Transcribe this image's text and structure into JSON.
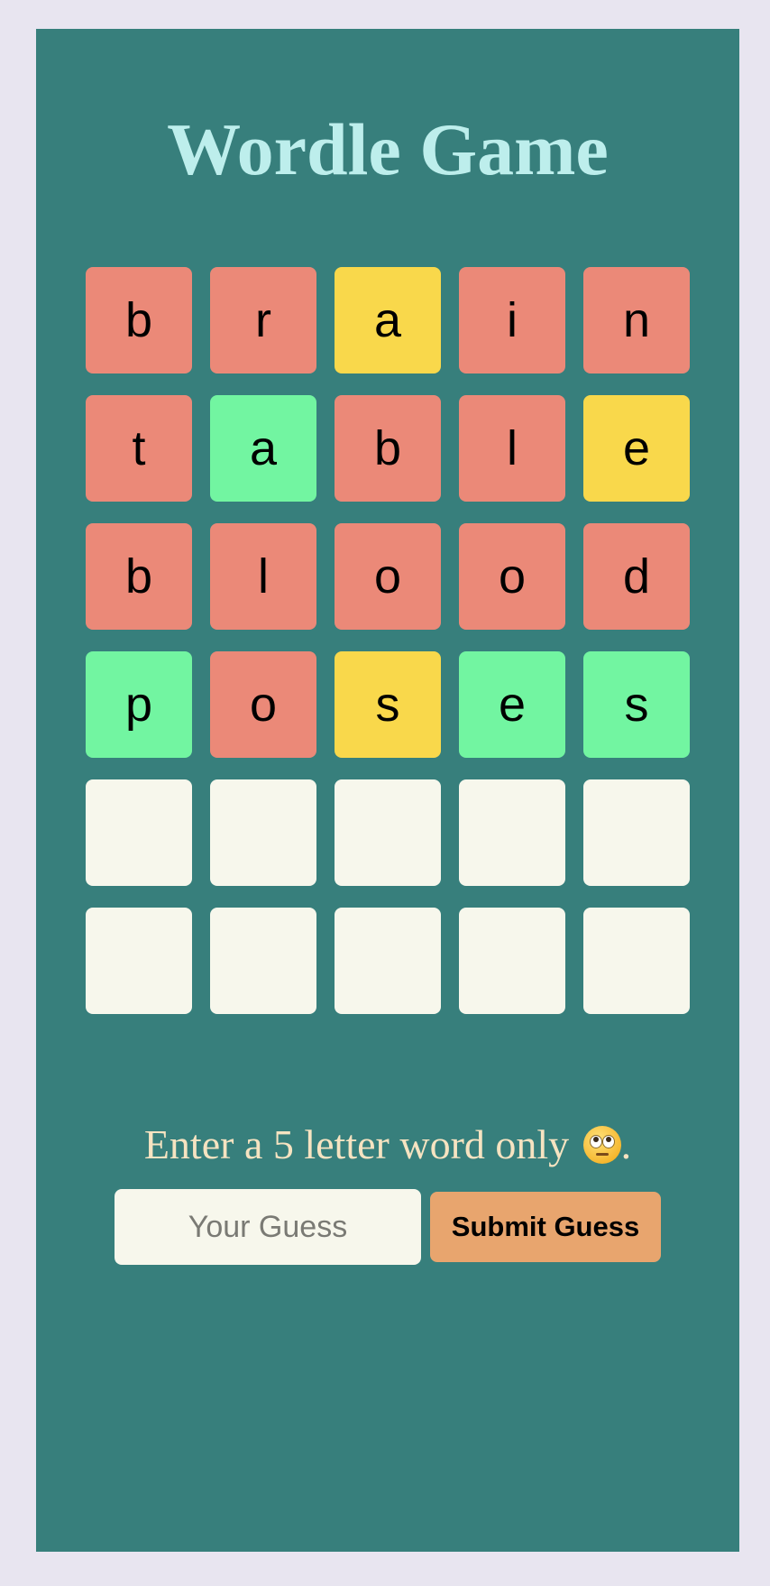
{
  "title": "Wordle Game",
  "board": {
    "rows": [
      [
        {
          "letter": "b",
          "state": "miss"
        },
        {
          "letter": "r",
          "state": "miss"
        },
        {
          "letter": "a",
          "state": "present"
        },
        {
          "letter": "i",
          "state": "miss"
        },
        {
          "letter": "n",
          "state": "miss"
        }
      ],
      [
        {
          "letter": "t",
          "state": "miss"
        },
        {
          "letter": "a",
          "state": "correct"
        },
        {
          "letter": "b",
          "state": "miss"
        },
        {
          "letter": "l",
          "state": "miss"
        },
        {
          "letter": "e",
          "state": "present"
        }
      ],
      [
        {
          "letter": "b",
          "state": "miss"
        },
        {
          "letter": "l",
          "state": "miss"
        },
        {
          "letter": "o",
          "state": "miss"
        },
        {
          "letter": "o",
          "state": "miss"
        },
        {
          "letter": "d",
          "state": "miss"
        }
      ],
      [
        {
          "letter": "p",
          "state": "correct"
        },
        {
          "letter": "o",
          "state": "miss"
        },
        {
          "letter": "s",
          "state": "present"
        },
        {
          "letter": "e",
          "state": "correct"
        },
        {
          "letter": "s",
          "state": "correct"
        }
      ],
      [
        {
          "letter": "",
          "state": "empty"
        },
        {
          "letter": "",
          "state": "empty"
        },
        {
          "letter": "",
          "state": "empty"
        },
        {
          "letter": "",
          "state": "empty"
        },
        {
          "letter": "",
          "state": "empty"
        }
      ],
      [
        {
          "letter": "",
          "state": "empty"
        },
        {
          "letter": "",
          "state": "empty"
        },
        {
          "letter": "",
          "state": "empty"
        },
        {
          "letter": "",
          "state": "empty"
        },
        {
          "letter": "",
          "state": "empty"
        }
      ]
    ]
  },
  "instruction": {
    "text": "Enter a 5 letter word only",
    "icon": "eye-roll-emoji-icon",
    "suffix": "."
  },
  "guess": {
    "value": "",
    "placeholder": "Your Guess"
  },
  "submit_label": "Submit Guess",
  "colors": {
    "page_background": "#e8e5f0",
    "panel": "#377f7c",
    "title": "#bdeeec",
    "miss": "#eb8978",
    "present": "#f9d84b",
    "correct": "#72f5a1",
    "empty": "#f7f7ec",
    "instruction_text": "#f6e3c1",
    "submit_button": "#e8a56e"
  }
}
